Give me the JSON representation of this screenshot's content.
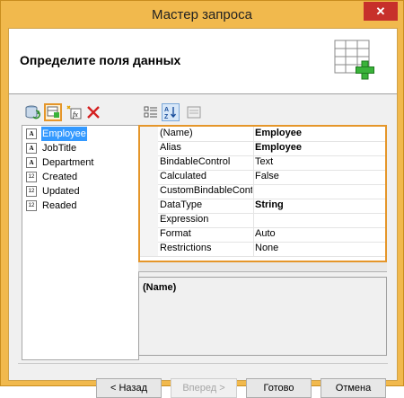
{
  "window": {
    "title": "Мастер запроса",
    "close_glyph": "✕"
  },
  "header": {
    "title": "Определите поля данных",
    "icon": "table-add-icon"
  },
  "left_toolbar": {
    "icons": [
      "refresh-database-icon",
      "add-field-icon",
      "add-calculated-field-icon",
      "delete-icon"
    ]
  },
  "right_toolbar": {
    "icons": [
      "categorized-view-icon",
      "sort-alphabetical-icon",
      "property-pages-icon"
    ]
  },
  "fields": [
    {
      "type_glyph": "A",
      "name": "Employee",
      "selected": true
    },
    {
      "type_glyph": "A",
      "name": "JobTitle"
    },
    {
      "type_glyph": "A",
      "name": "Department"
    },
    {
      "type_glyph": "12",
      "name": "Created"
    },
    {
      "type_glyph": "12",
      "name": "Updated"
    },
    {
      "type_glyph": "12",
      "name": "Readed"
    }
  ],
  "properties": [
    {
      "name": "(Name)",
      "value": "Employee",
      "bold": true
    },
    {
      "name": "Alias",
      "value": "Employee",
      "bold": true
    },
    {
      "name": "BindableControl",
      "value": "Text"
    },
    {
      "name": "Calculated",
      "value": "False"
    },
    {
      "name": "CustomBindableControl",
      "value": ""
    },
    {
      "name": "DataType",
      "value": "String",
      "bold": true
    },
    {
      "name": "Expression",
      "value": ""
    },
    {
      "name": "Format",
      "value": "Auto"
    },
    {
      "name": "Restrictions",
      "value": "None"
    }
  ],
  "description": {
    "title": "(Name)"
  },
  "buttons": {
    "back": "< Назад",
    "next": "Вперед >",
    "finish": "Готово",
    "cancel": "Отмена"
  },
  "colors": {
    "titlebar": "#f1b94d",
    "highlight": "#e5962a",
    "selection": "#3399ff",
    "close": "#c7302b"
  }
}
